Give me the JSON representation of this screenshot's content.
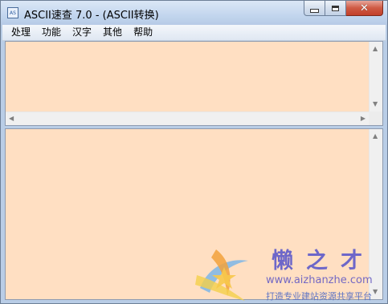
{
  "window": {
    "icon_text": "AS",
    "title": "ASCII速查 7.0 - (ASCII转换)"
  },
  "caption_buttons": {
    "close_glyph": "✕"
  },
  "menu": {
    "items": [
      "处理",
      "功能",
      "汉字",
      "其他",
      "帮助"
    ]
  },
  "panes": {
    "top_text": "",
    "bottom_text": "",
    "background_color": "#ffdfc2"
  },
  "scroll_arrows": {
    "up": "▲",
    "down": "▼",
    "left": "◀",
    "right": "▶"
  },
  "watermark": {
    "title": "懒之才",
    "url": "www.aizhanzhe.com",
    "slogan": "打造专业建站资源共享平台"
  }
}
